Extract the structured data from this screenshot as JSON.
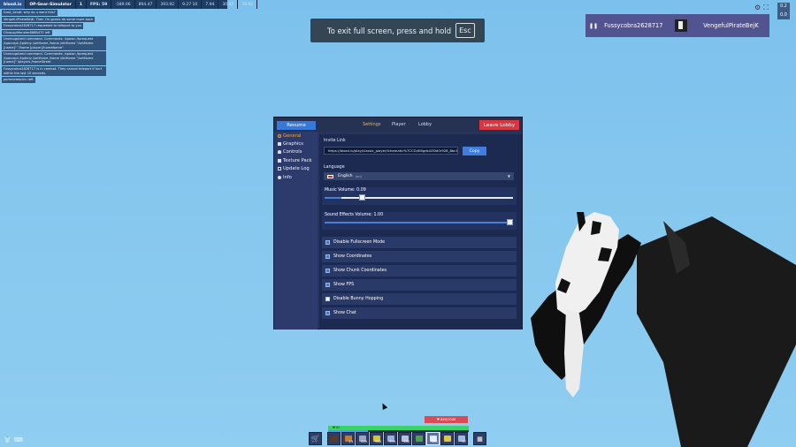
{
  "topbar": {
    "logo": "bloxd.io",
    "server": "OP-Gear-Simulator",
    "lobby_num": "1",
    "fps": "FPS: 59",
    "coords": [
      "-189.06",
      "894.47",
      "393.92",
      "9.27 10",
      "7.94",
      "30.47",
      "39.92"
    ]
  },
  "chat": [
    "Dust_1eluti: why do u want this?",
    "VengefulPirateBejK: Then I'm gonna do some more back",
    "Fussycobra2628717 requested to teleport to you",
    "OlnappyMonster8868470 left",
    "Unrecognized command. Commands: /spawn /tprequest /tpaccept /tpdeny /setHome /home /delHome \"/setHome [name]\" \"/home [player]/homeName\"",
    "Unrecognized command. Commands: /spawn /tprequest /tpaccept /tpdeny /setHome /home /delHome \"/setHome [name]\" /players /homeStreet",
    "Fussycobra2628717 is in combat. They cannot teleport if hurt within the last 10 seconds.",
    "pommerescinn left"
  ],
  "fullscreen_hint": {
    "text": "To exit full screen, press and hold",
    "key": "Esc"
  },
  "players_panel": {
    "pause_icon": "pause-icon",
    "player1": "Fussycobra2628717",
    "player2": "VengefulPirateBejK"
  },
  "corner_box": [
    "0.2",
    "0.0"
  ],
  "menu": {
    "resume_label": "Resume",
    "tabs": [
      {
        "label": "Settings",
        "active": true
      },
      {
        "label": "Player",
        "active": false
      },
      {
        "label": "Lobby",
        "active": false
      }
    ],
    "leave_label": "Leave Lobby",
    "sidebar": [
      {
        "label": "General",
        "icon": "gear-icon",
        "active": true
      },
      {
        "label": "Graphics",
        "icon": "image-icon",
        "active": false
      },
      {
        "label": "Controls",
        "icon": "person-icon",
        "active": false
      },
      {
        "label": "Texture Pack",
        "icon": "folder-icon",
        "active": false
      },
      {
        "label": "Update Log",
        "icon": "document-icon",
        "active": false
      },
      {
        "label": "Info",
        "icon": "info-icon",
        "active": false
      }
    ],
    "invite": {
      "label": "Invite Link",
      "url": "https://bloxd.io/play/classic_player/lchematic%7CCGnE8gdsl430d0r928_8bc1",
      "copy_label": "Copy"
    },
    "language": {
      "label": "Language",
      "value": "English",
      "value_suffix": "(en)"
    },
    "music": {
      "label": "Music Volume: 0.09",
      "value": 0.09
    },
    "sfx": {
      "label": "Sound Effects Volume: 1.00",
      "value": 1.0
    },
    "toggles": [
      {
        "label": "Disable Fullscreen Mode",
        "checked": true
      },
      {
        "label": "Show Coordinates",
        "checked": true
      },
      {
        "label": "Show Chunk Coordinates",
        "checked": true
      },
      {
        "label": "Show FPS",
        "checked": true
      },
      {
        "label": "Disable Bunny Hopping",
        "checked": false
      },
      {
        "label": "Show Chat",
        "checked": true
      }
    ]
  },
  "hud": {
    "hp_tag": "♥ 840/1040",
    "health_text": "♥ 82",
    "health_value": 1.0,
    "xp_value": 0.28,
    "hotbar": [
      {
        "icon": "sword-icon",
        "count": "",
        "color": "#5a3a20"
      },
      {
        "icon": "cookie-icon",
        "count": "23",
        "color": "#c47a2b"
      },
      {
        "icon": "helmet-icon",
        "count": "229",
        "color": "#9aa4c0"
      },
      {
        "icon": "gold-block-icon",
        "count": "940",
        "color": "#d6c437"
      },
      {
        "icon": "armor-icon",
        "count": "999",
        "color": "#9ab0d6"
      },
      {
        "icon": "sword-icon",
        "count": "132",
        "color": "#b7c2d8"
      },
      {
        "icon": "rod-icon",
        "count": "",
        "color": "#4aa24a"
      },
      {
        "icon": "block-icon",
        "count": "101",
        "color": "#e7ecf5"
      },
      {
        "icon": "gold-block-icon",
        "count": "",
        "color": "#e3c63c"
      },
      {
        "icon": "pickaxe-icon",
        "count": "97",
        "color": "#9fbadf"
      }
    ]
  }
}
